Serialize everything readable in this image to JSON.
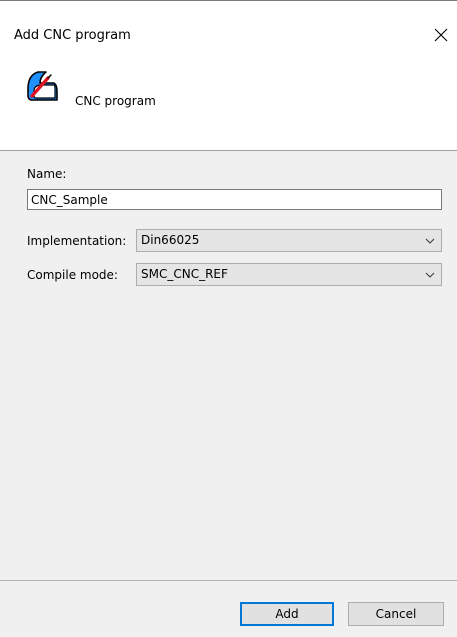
{
  "dialog": {
    "title": "Add CNC program"
  },
  "header": {
    "program_type_label": "CNC program",
    "icon": "cnc-program-icon"
  },
  "form": {
    "name_label": "Name:",
    "name_value": "CNC_Sample",
    "implementation_label": "Implementation:",
    "implementation_value": "Din66025",
    "compile_mode_label": "Compile mode:",
    "compile_mode_value": "SMC_CNC_REF"
  },
  "buttons": {
    "add_label": "Add",
    "cancel_label": "Cancel"
  },
  "colors": {
    "accent": "#0078d7",
    "icon_blue": "#1e90ff",
    "icon_red": "#e01020",
    "panel_bg": "#f0f0f0"
  }
}
